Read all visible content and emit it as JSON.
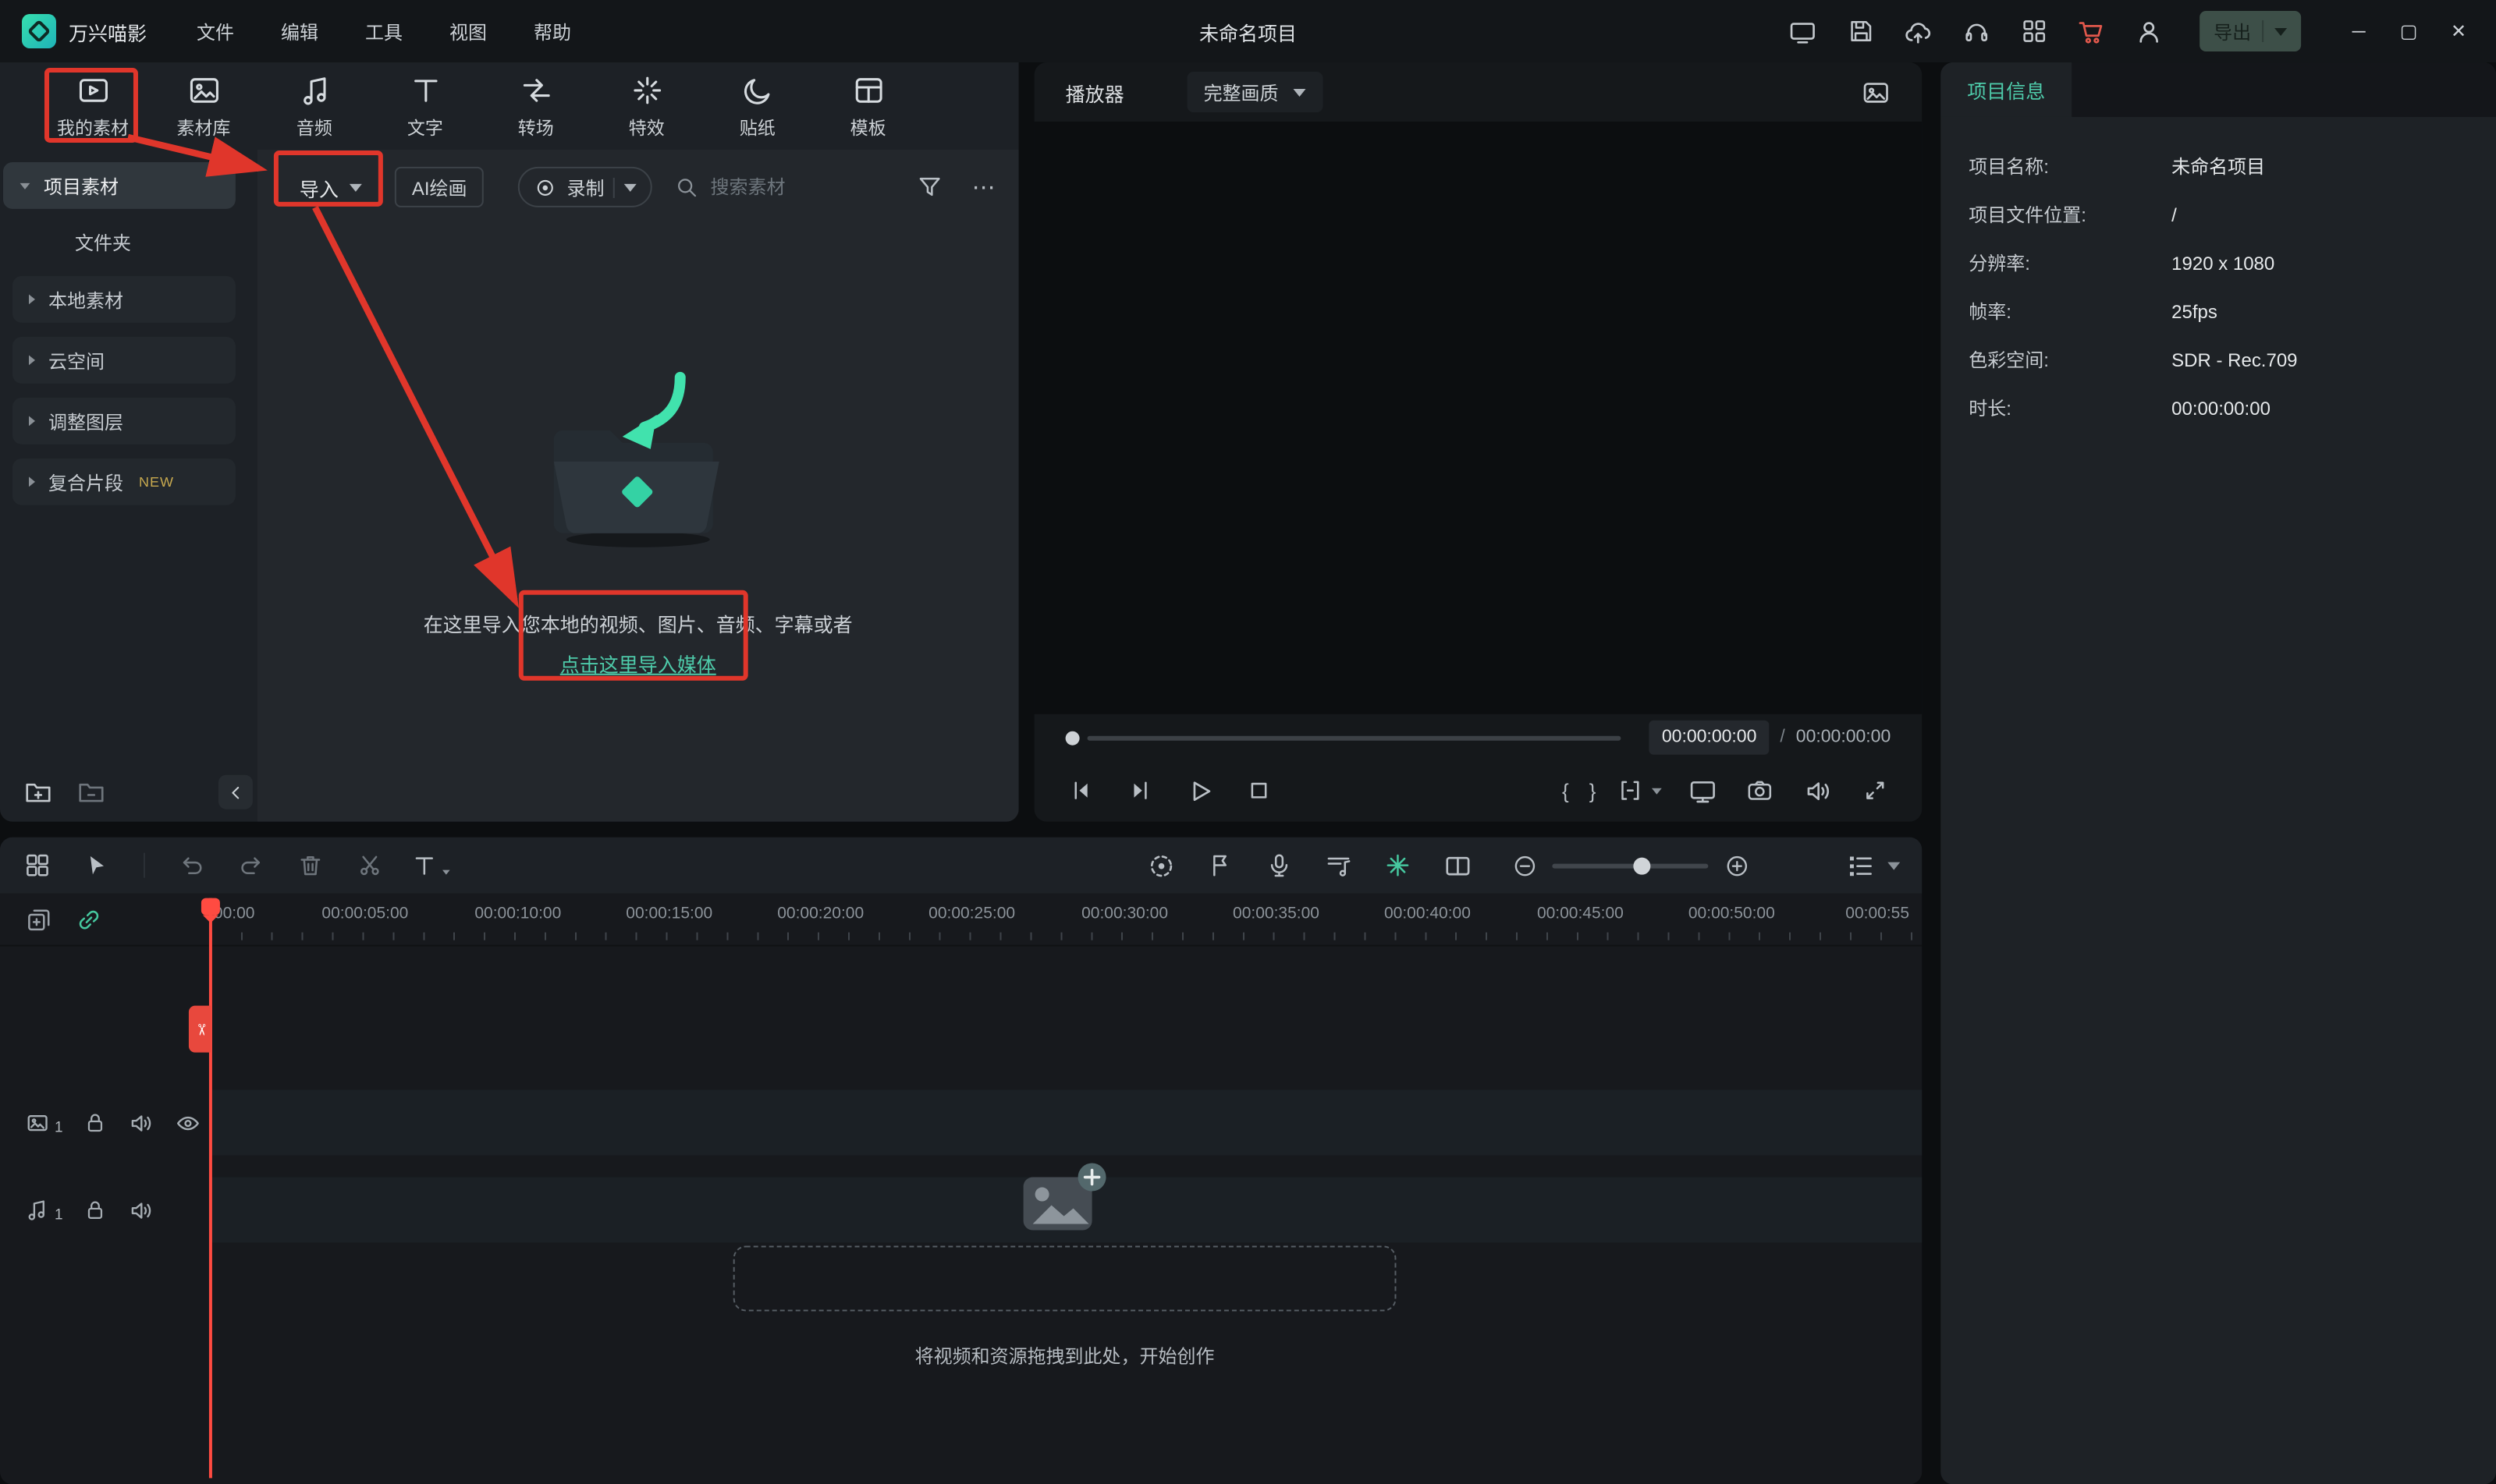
{
  "colors": {
    "accent": "#4ecbaa",
    "annotation": "#e0362b",
    "playhead": "#ff4b41",
    "record_red": "#e2584c"
  },
  "glyphs": {
    "mark_in": "{",
    "mark_out": "}",
    "more": "⋯",
    "scissors": "✂",
    "slash": "/",
    "window_minimize": "─",
    "window_maximize": "▢",
    "window_close": "✕"
  },
  "titlebar": {
    "app_name": "万兴喵影",
    "menus": [
      "文件",
      "编辑",
      "工具",
      "视图",
      "帮助"
    ],
    "project_title": "未命名项目",
    "export_label": "导出"
  },
  "media_panel": {
    "tabs": [
      {
        "label": "我的素材"
      },
      {
        "label": "素材库"
      },
      {
        "label": "音频"
      },
      {
        "label": "文字"
      },
      {
        "label": "转场"
      },
      {
        "label": "特效"
      },
      {
        "label": "贴纸"
      },
      {
        "label": "模板"
      }
    ],
    "sidebar": [
      {
        "label": "项目素材"
      },
      {
        "label": "文件夹"
      },
      {
        "label": "本地素材"
      },
      {
        "label": "云空间"
      },
      {
        "label": "调整图层"
      },
      {
        "label": "复合片段",
        "badge": "NEW"
      }
    ],
    "toolbar": {
      "import_label": "导入",
      "ai_paint_label": "AI绘画",
      "record_label": "录制",
      "search_placeholder": "搜索素材"
    },
    "empty_state": {
      "line1": "在这里导入您本地的视频、图片、音频、字幕或者",
      "link_label": "点击这里导入媒体"
    }
  },
  "player": {
    "title": "播放器",
    "quality": "完整画质",
    "time_current": "00:00:00:00",
    "time_total": "00:00:00:00"
  },
  "project_info": {
    "tab_label": "项目信息",
    "rows": [
      {
        "label": "项目名称:",
        "value": "未命名项目"
      },
      {
        "label": "项目文件位置:",
        "value": "/"
      },
      {
        "label": "分辨率:",
        "value": "1920 x 1080"
      },
      {
        "label": "帧率:",
        "value": "25fps"
      },
      {
        "label": "色彩空间:",
        "value": "SDR - Rec.709"
      },
      {
        "label": "时长:",
        "value": "00:00:00:00"
      }
    ]
  },
  "timeline": {
    "ruler": [
      "00:00",
      "00:00:05:00",
      "00:00:10:00",
      "00:00:15:00",
      "00:00:20:00",
      "00:00:25:00",
      "00:00:30:00",
      "00:00:35:00",
      "00:00:40:00",
      "00:00:45:00",
      "00:00:50:00",
      "00:00:55"
    ],
    "video_track_label": "1",
    "audio_track_label": "1",
    "drop_hint": "将视频和资源拖拽到此处，开始创作"
  }
}
